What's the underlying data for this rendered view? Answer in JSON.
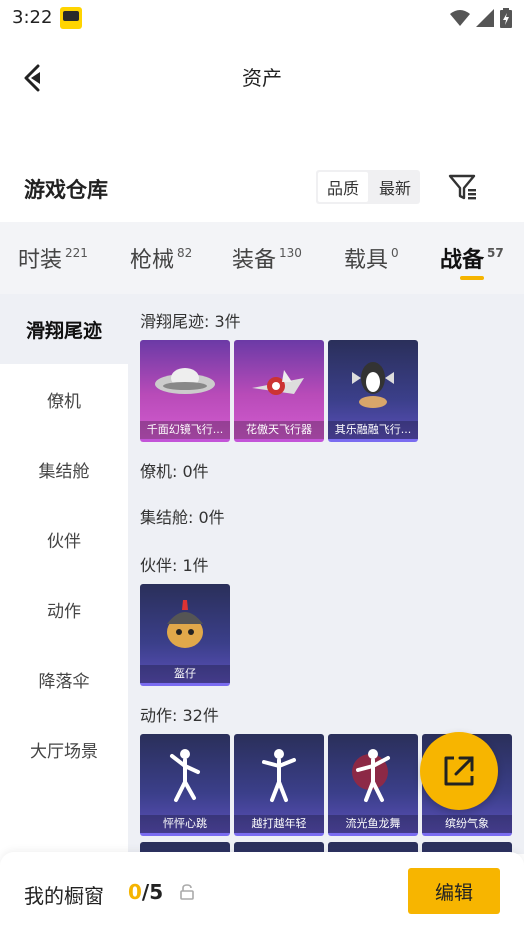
{
  "status": {
    "time": "3:22"
  },
  "header": {
    "title": "资产"
  },
  "warehouse": {
    "title": "游戏仓库",
    "sort_options": [
      "品质",
      "最新"
    ]
  },
  "tabs": [
    {
      "label": "时装",
      "count": "221"
    },
    {
      "label": "枪械",
      "count": "82"
    },
    {
      "label": "装备",
      "count": "130"
    },
    {
      "label": "载具",
      "count": "0"
    },
    {
      "label": "战备",
      "count": "57"
    }
  ],
  "sidebar": {
    "items": [
      "滑翔尾迹",
      "僚机",
      "集结舱",
      "伙伴",
      "动作",
      "降落伞",
      "大厅场景"
    ]
  },
  "groups": {
    "glide": {
      "title": "滑翔尾迹: 3件",
      "items": [
        "千面幻镜飞行...",
        "花傲天飞行器",
        "其乐融融飞行..."
      ]
    },
    "wingman": {
      "title": "僚机: 0件"
    },
    "pod": {
      "title": "集结舱: 0件"
    },
    "partner": {
      "title": "伙伴: 1件",
      "items": [
        "盔仔"
      ]
    },
    "emote": {
      "title": "动作: 32件",
      "items": [
        "怦怦心跳",
        "越打越年轻",
        "流光鱼龙舞",
        "缤纷气象"
      ]
    }
  },
  "bottom": {
    "label": "我的橱窗",
    "count_current": "0",
    "count_total": "/5",
    "edit_label": "编辑"
  }
}
